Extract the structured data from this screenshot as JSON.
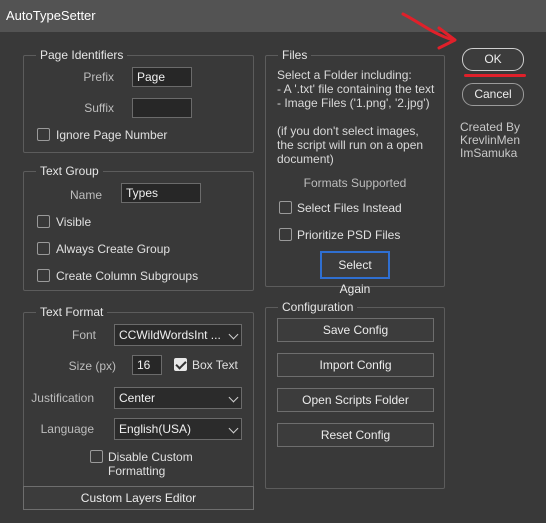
{
  "window": {
    "title": "AutoTypeSetter"
  },
  "page_identifiers": {
    "title": "Page Identifiers",
    "prefix_label": "Prefix",
    "prefix_value": "Page",
    "suffix_label": "Suffix",
    "suffix_value": "",
    "ignore_page_number_label": "Ignore Page Number",
    "ignore_page_number_checked": false
  },
  "text_group": {
    "title": "Text Group",
    "name_label": "Name",
    "name_value": "Types",
    "visible_label": "Visible",
    "always_create_group_label": "Always Create Group",
    "create_column_subgroups_label": "Create Column Subgroups"
  },
  "text_format": {
    "title": "Text Format",
    "font_label": "Font",
    "font_value": "CCWildWordsInt ...",
    "size_label": "Size (px)",
    "size_value": "16",
    "box_text_label": "Box Text",
    "box_text_checked": true,
    "justification_label": "Justification",
    "justification_value": "Center",
    "language_label": "Language",
    "language_value": "English(USA)",
    "disable_custom_formatting_label": "Disable Custom Formatting"
  },
  "custom_layers_editor_label": "Custom Layers Editor",
  "files": {
    "title": "Files",
    "desc_line1": "Select a Folder including:",
    "desc_line2": "- A '.txt' file containing the text",
    "desc_line3": "- Image Files ('1.png', '2.jpg')",
    "note_line1": "(if you don't select images,",
    "note_line2": "the script will run on a open",
    "note_line3": "document)",
    "formats_supported": "Formats Supported",
    "select_files_instead_label": "Select Files Instead",
    "prioritize_psd_label": "Prioritize PSD Files",
    "select_again_label": "Select Again"
  },
  "configuration": {
    "title": "Configuration",
    "save_config": "Save Config",
    "import_config": "Import Config",
    "open_scripts_folder": "Open Scripts Folder",
    "reset_config": "Reset Config"
  },
  "actions": {
    "ok": "OK",
    "cancel": "Cancel"
  },
  "credits": {
    "line1": "Created By",
    "line2": "KrevlinMen",
    "line3": "ImSamuka"
  },
  "colors": {
    "annotation": "#e0202a",
    "focus": "#2f6fd1"
  }
}
